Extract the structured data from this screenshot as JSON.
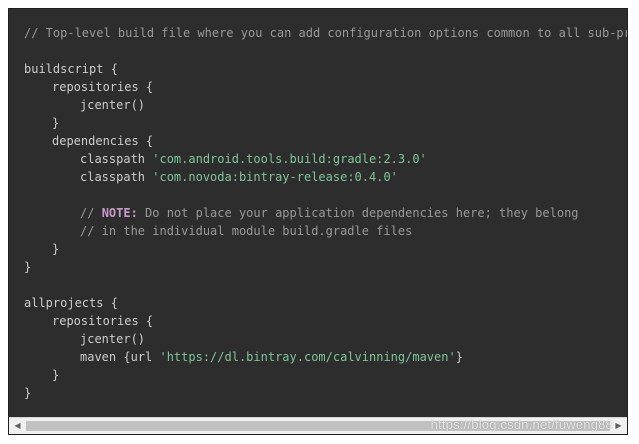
{
  "code": {
    "line1": "// Top-level build file where you can add configuration options common to all sub-pro",
    "line3": "buildscript {",
    "line4": "repositories {",
    "line5": "jcenter()",
    "line6": "}",
    "line7": "dependencies {",
    "line8_kw": "classpath ",
    "line8_str": "'com.android.tools.build:gradle:2.3.0'",
    "line9_kw": "classpath ",
    "line9_str": "'com.novoda:bintray-release:0.4.0'",
    "line11_prefix": "// ",
    "line11_note": "NOTE:",
    "line11_rest": " Do not place your application dependencies here; they belong",
    "line12": "// in the individual module build.gradle files",
    "line13": "}",
    "line14": "}",
    "line16": "allprojects {",
    "line17": "repositories {",
    "line18": "jcenter()",
    "line19_kw": "maven {url ",
    "line19_str": "'https://dl.bintray.com/calvinning/maven'",
    "line19_end": "}",
    "line20": "}",
    "line21": "}"
  },
  "scrollbar": {
    "left_arrow": "◀",
    "right_arrow": "▶"
  },
  "watermark": "https://blog.csdn.net/fuweng88",
  "colors": {
    "background": "#2d2d2d",
    "text": "#cccccc",
    "comment": "#999999",
    "string": "#7ec699",
    "keyword_note": "#cc99cd"
  }
}
